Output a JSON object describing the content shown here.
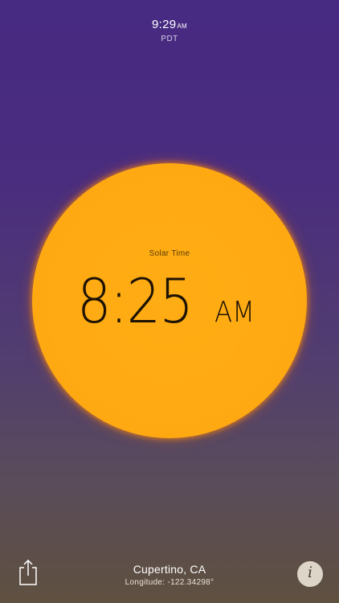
{
  "status": {
    "time": "9:29",
    "ampm": "AM",
    "timezone": "PDT"
  },
  "solar": {
    "label": "Solar Time",
    "time": "8:25",
    "ampm": "AM"
  },
  "location": {
    "city": "Cupertino, CA",
    "longitude": "Longitude: -122.34298°"
  },
  "colors": {
    "sun": "#ffa912",
    "background_top": "#472a82",
    "background_bottom": "#5f503f"
  },
  "icons": {
    "share": "share-icon",
    "info": "info-icon"
  }
}
